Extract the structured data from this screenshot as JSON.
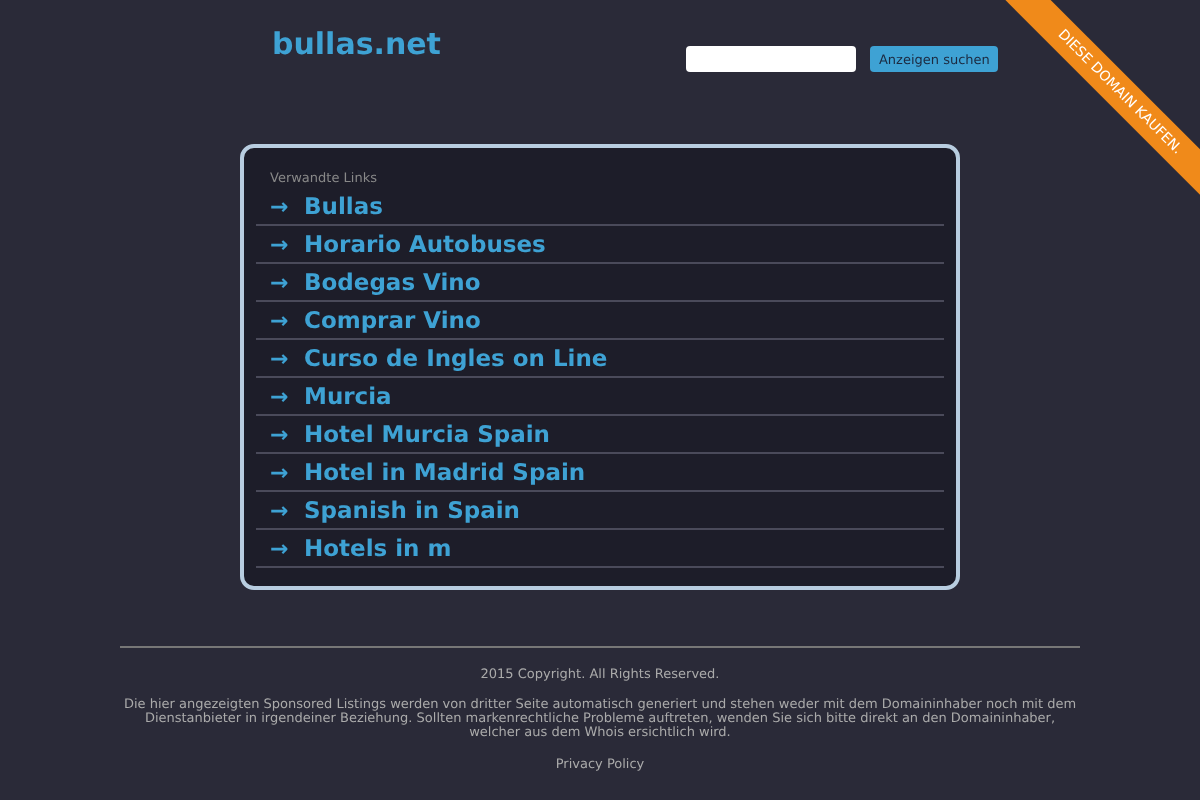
{
  "header": {
    "logo": "bullas.net",
    "search": {
      "button": "Anzeigen suchen"
    }
  },
  "ribbon": "DIESE DOMAIN KAUFEN.",
  "links": {
    "title": "Verwandte Links",
    "items": [
      {
        "arrow": "→",
        "label": "Bullas"
      },
      {
        "arrow": "→",
        "label": "Horario Autobuses"
      },
      {
        "arrow": "→",
        "label": "Bodegas Vino"
      },
      {
        "arrow": "→",
        "label": "Comprar Vino"
      },
      {
        "arrow": "→",
        "label": "Curso de Ingles on Line"
      },
      {
        "arrow": "→",
        "label": "Murcia"
      },
      {
        "arrow": "→",
        "label": "Hotel Murcia Spain"
      },
      {
        "arrow": "→",
        "label": "Hotel in Madrid Spain"
      },
      {
        "arrow": "→",
        "label": "Spanish in Spain"
      },
      {
        "arrow": "→",
        "label": "Hotels in m"
      }
    ]
  },
  "footer": {
    "copyright": "2015 Copyright. All Rights Reserved.",
    "disclaimer": "Die hier angezeigten Sponsored Listings werden von dritter Seite automatisch generiert und stehen weder mit dem Domaininhaber noch mit dem Dienstanbieter in irgendeiner Beziehung. Sollten markenrechtliche Probleme auftreten, wenden Sie sich bitte direkt an den Domaininhaber, welcher aus dem Whois ersichtlich wird.",
    "privacy": "Privacy Policy"
  }
}
